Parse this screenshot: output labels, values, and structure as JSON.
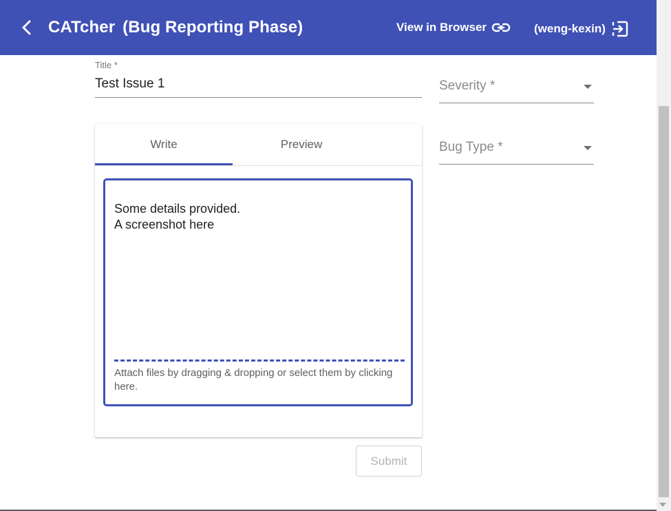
{
  "app": {
    "title_name": "CATcher",
    "title_phase": "(Bug Reporting Phase)",
    "view_in_browser": "View in Browser",
    "username": "(weng-kexin)",
    "accent_color": "#3f51b5"
  },
  "form": {
    "title_label": "Title *",
    "title_value": "Test Issue 1",
    "severity_label": "Severity *",
    "bug_type_label": "Bug Type *",
    "tabs": [
      {
        "label": "Write",
        "active": true
      },
      {
        "label": "Preview",
        "active": false
      }
    ],
    "description": "Some details provided.\nA screenshot here",
    "attach_hint": "Attach files by dragging & dropping or select them by clicking here.",
    "submit_label": "Submit",
    "submit_disabled": true
  },
  "icons": [
    "back-arrow-icon",
    "link-icon",
    "logout-icon",
    "dropdown-arrow-icon"
  ]
}
